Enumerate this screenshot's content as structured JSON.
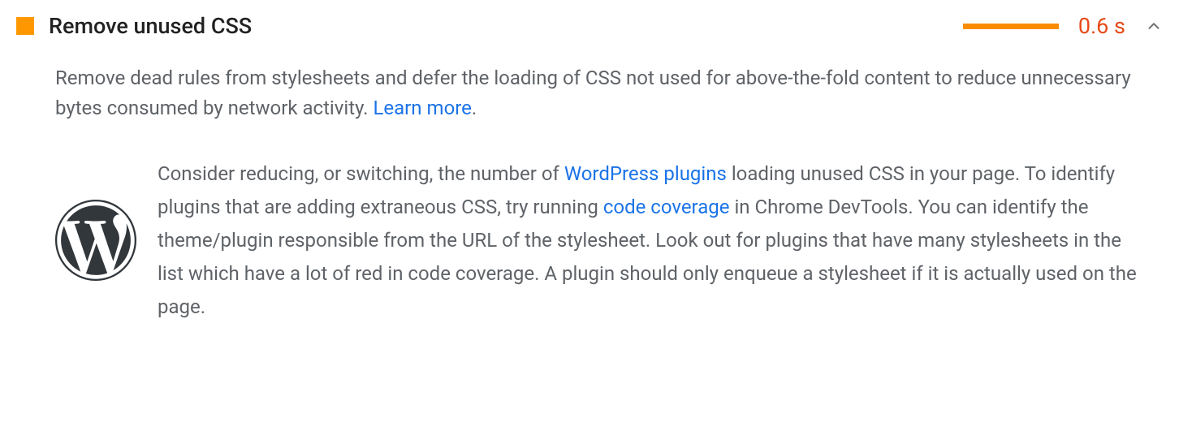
{
  "audit": {
    "title": "Remove unused CSS",
    "metric": "0.6 s",
    "description_parts": {
      "t1": "Remove dead rules from stylesheets and defer the loading of CSS not used for above-the-fold content to reduce unnecessary bytes consumed by network activity. ",
      "learn_more": "Learn more",
      "t2": "."
    },
    "stack_pack": {
      "p1": "Consider reducing, or switching, the number of ",
      "link1": "WordPress plugins",
      "p2": " loading unused CSS in your page. To identify plugins that are adding extraneous CSS, try running ",
      "link2": "code coverage",
      "p3": " in Chrome DevTools. You can identify the theme/plugin responsible from the URL of the stylesheet. Look out for plugins that have many stylesheets in the list which have a lot of red in code coverage. A plugin should only enqueue a stylesheet if it is actually used on the page."
    }
  }
}
